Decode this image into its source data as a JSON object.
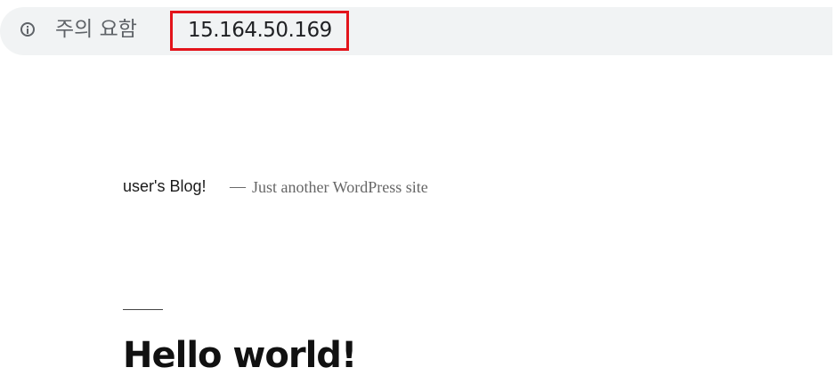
{
  "address_bar": {
    "security_label": "주의 요함",
    "url": "15.164.50.169",
    "icon": "info-icon",
    "highlight_color": "#e3141b"
  },
  "site": {
    "title": "user's Blog!",
    "separator": "—",
    "description": "Just another WordPress site"
  },
  "post": {
    "title": "Hello world!"
  }
}
